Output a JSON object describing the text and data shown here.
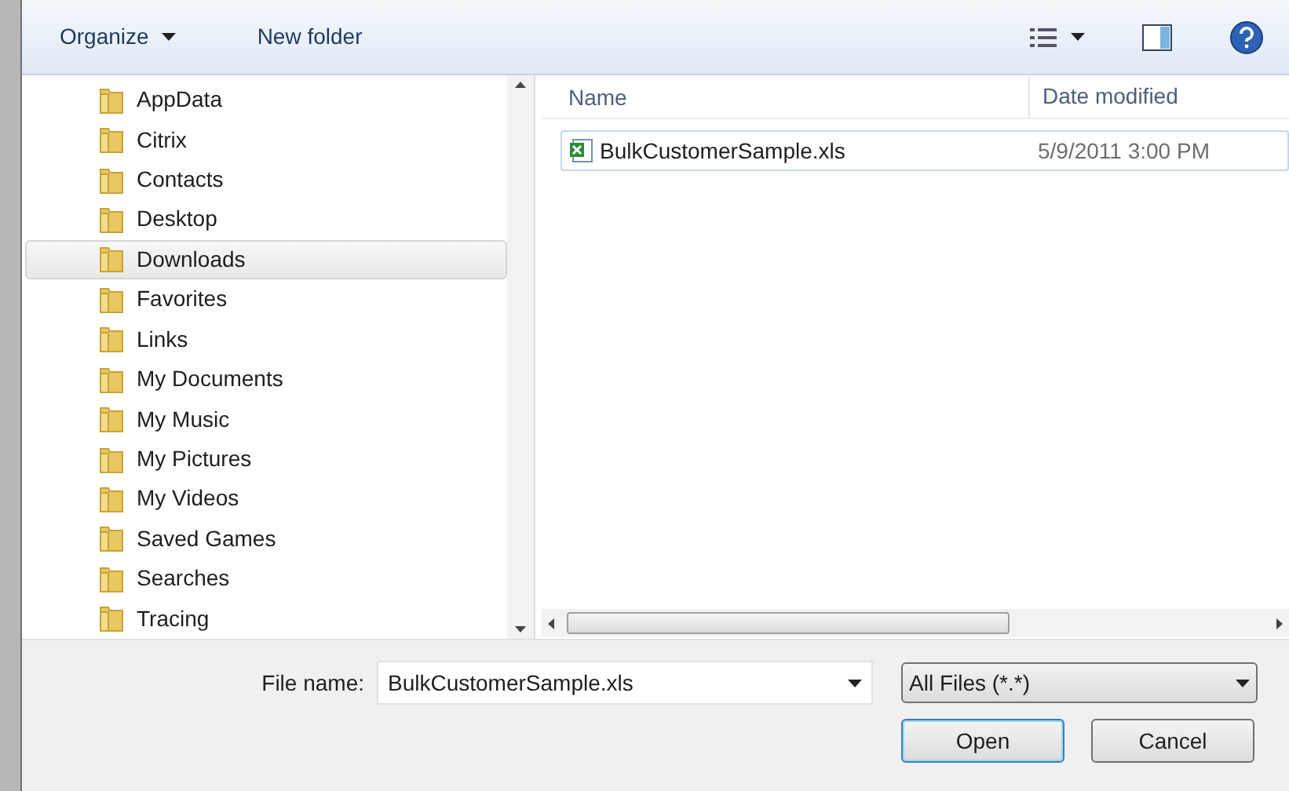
{
  "toolbar": {
    "organize": "Organize",
    "new_folder": "New folder"
  },
  "folders": [
    {
      "label": "AppData",
      "selected": false
    },
    {
      "label": "Citrix",
      "selected": false
    },
    {
      "label": "Contacts",
      "selected": false
    },
    {
      "label": "Desktop",
      "selected": false
    },
    {
      "label": "Downloads",
      "selected": true
    },
    {
      "label": "Favorites",
      "selected": false
    },
    {
      "label": "Links",
      "selected": false
    },
    {
      "label": "My Documents",
      "selected": false
    },
    {
      "label": "My Music",
      "selected": false
    },
    {
      "label": "My Pictures",
      "selected": false
    },
    {
      "label": "My Videos",
      "selected": false
    },
    {
      "label": "Saved Games",
      "selected": false
    },
    {
      "label": "Searches",
      "selected": false
    },
    {
      "label": "Tracing",
      "selected": false
    }
  ],
  "columns": [
    "Name",
    "Date modified"
  ],
  "files": [
    {
      "name": "BulkCustomerSample.xls",
      "date": "5/9/2011 3:00 PM",
      "selected": false
    }
  ],
  "file_name": {
    "label": "File name:",
    "value": "BulkCustomerSample.xls"
  },
  "file_type": "All Files (*.*)",
  "buttons": [
    "Open",
    "Cancel"
  ]
}
